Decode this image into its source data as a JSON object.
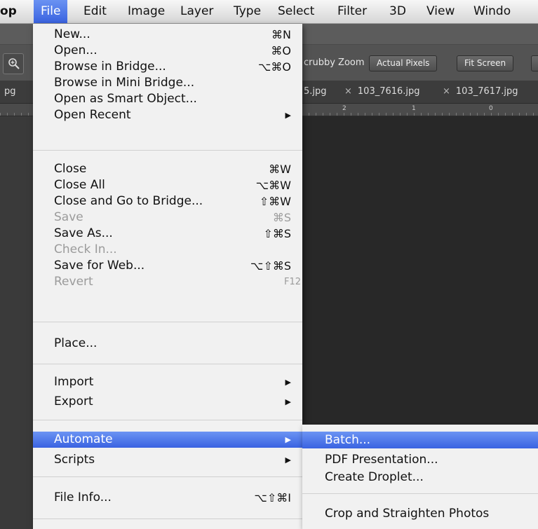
{
  "menubar": {
    "items": [
      "op",
      "File",
      "Edit",
      "Image",
      "Layer",
      "Type",
      "Select",
      "Filter",
      "3D",
      "View",
      "Windo"
    ],
    "selected": "File"
  },
  "options_bar": {
    "scrubby_zoom_label": "crubby Zoom",
    "buttons": [
      "Actual Pixels",
      "Fit Screen"
    ]
  },
  "doc_tabs": {
    "left_fragment": "pg",
    "tabs": [
      "5.jpg",
      "103_7616.jpg",
      "103_7617.jpg"
    ],
    "close_glyph": "×"
  },
  "ruler": {
    "numbers": [
      "2",
      "1",
      "0"
    ]
  },
  "file_menu": {
    "items": [
      {
        "label": "New...",
        "shortcut": "⌘N"
      },
      {
        "label": "Open...",
        "shortcut": "⌘O"
      },
      {
        "label": "Browse in Bridge...",
        "shortcut": "⌥⌘O"
      },
      {
        "label": "Browse in Mini Bridge...",
        "shortcut": ""
      },
      {
        "label": "Open as Smart Object...",
        "shortcut": ""
      },
      {
        "label": "Open Recent",
        "submenu": true
      },
      {
        "label": "Close",
        "shortcut": "⌘W"
      },
      {
        "label": "Close All",
        "shortcut": "⌥⌘W"
      },
      {
        "label": "Close and Go to Bridge...",
        "shortcut": "⇧⌘W"
      },
      {
        "label": "Save",
        "shortcut": "⌘S",
        "disabled": true
      },
      {
        "label": "Save As...",
        "shortcut": "⇧⌘S"
      },
      {
        "label": "Check In...",
        "shortcut": "",
        "disabled": true
      },
      {
        "label": "Save for Web...",
        "shortcut": "⌥⇧⌘S"
      },
      {
        "label": "Revert",
        "shortcut": "F12",
        "disabled": true
      },
      {
        "label": "Place...",
        "shortcut": ""
      },
      {
        "label": "Import",
        "submenu": true
      },
      {
        "label": "Export",
        "submenu": true
      },
      {
        "label": "Automate",
        "submenu": true,
        "highlighted": true
      },
      {
        "label": "Scripts",
        "submenu": true
      },
      {
        "label": "File Info...",
        "shortcut": "⌥⇧⌘I"
      }
    ],
    "submenu_arrow": "▶"
  },
  "automate_submenu": {
    "items": [
      "Batch...",
      "PDF Presentation...",
      "Create Droplet...",
      "Crop and Straighten Photos"
    ],
    "highlighted": "Batch..."
  },
  "colors": {
    "menu_highlight": "#3a63e1",
    "menu_bg": "#f1f1f1",
    "disabled_text": "#9b9b9b",
    "ps_dark": "#282828"
  }
}
